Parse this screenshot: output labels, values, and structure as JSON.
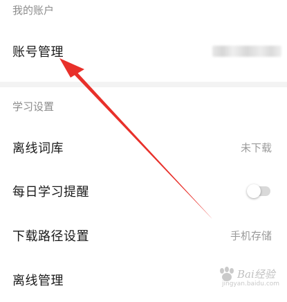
{
  "account_section": {
    "header": "我的账户",
    "account_management": {
      "label": "账号管理"
    }
  },
  "study_section": {
    "header": "学习设置",
    "offline_dictionary": {
      "label": "离线词库",
      "value": "未下载"
    },
    "daily_reminder": {
      "label": "每日学习提醒",
      "enabled": false
    },
    "download_path": {
      "label": "下载路径设置",
      "value": "手机存储"
    },
    "offline_management": {
      "label": "离线管理"
    }
  },
  "colors": {
    "arrow": "#e8302a",
    "divider": "#f3f3f3",
    "secondary_text": "#9a9a9a"
  },
  "watermark": {
    "text": "Bai经验",
    "url": "jingyan.baidu.com"
  }
}
